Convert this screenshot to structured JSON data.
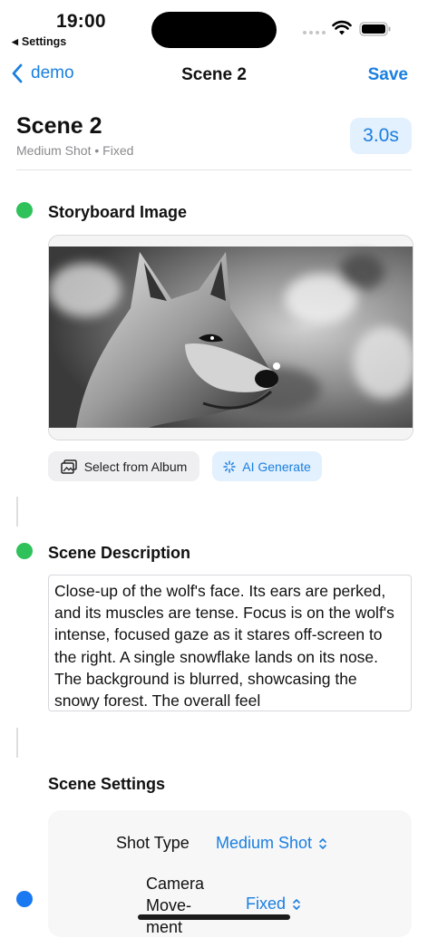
{
  "status_bar": {
    "time": "19:00",
    "back_app": "Settings"
  },
  "nav": {
    "back_label": "demo",
    "title": "Scene 2",
    "save_label": "Save"
  },
  "header": {
    "title": "Scene 2",
    "subtitle": "Medium Shot • Fixed",
    "duration": "3.0s"
  },
  "storyboard": {
    "title": "Storyboard Image",
    "status_color": "#2fc15a",
    "image_alt": "wolf-close-up-image",
    "select_album_label": "Select from Album",
    "ai_generate_label": "AI Generate"
  },
  "description": {
    "title": "Scene Description",
    "status_color": "#2fc15a",
    "text": "Close-up of the wolf's face. Its ears are perked, and its muscles are tense. Focus is on the wolf's intense, focused gaze as it stares off-screen to the right. A single snowflake lands on its nose. The background is blurred, showcasing the snowy forest. The overall feel"
  },
  "settings": {
    "title": "Scene Settings",
    "status_color": "#1a78f0",
    "shot_type_label": "Shot Type",
    "shot_type_value": "Medium Shot",
    "camera_movement_label": "Camera Move-ment",
    "camera_movement_value": "Fixed"
  },
  "colors": {
    "accent": "#1a7fe0",
    "accent_bg": "#e3f0fd"
  }
}
